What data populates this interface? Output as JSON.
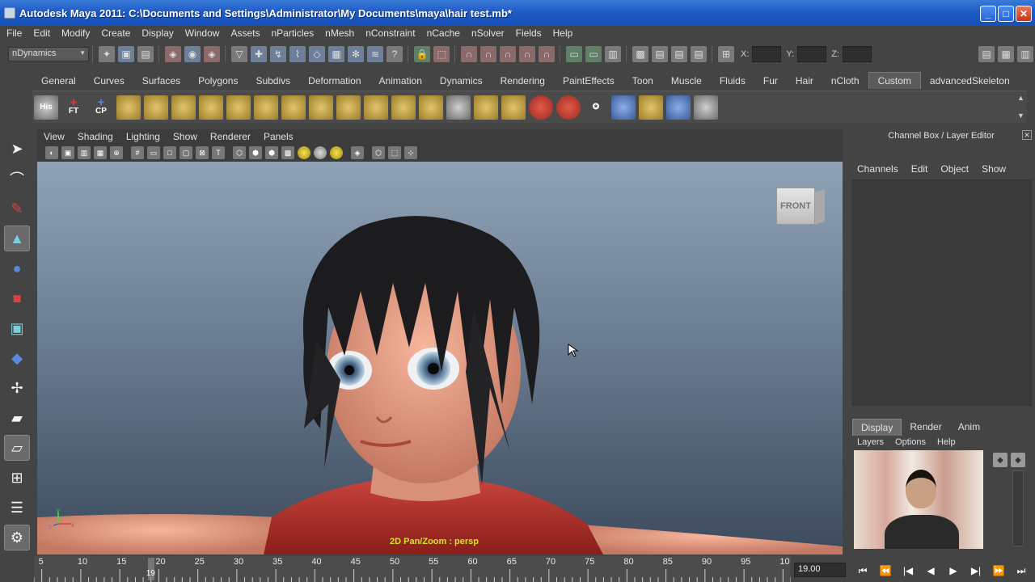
{
  "window": {
    "title": "Autodesk Maya 2011: C:\\Documents and Settings\\Administrator\\My Documents\\maya\\hair test.mb*",
    "minimize": "_",
    "maximize": "□",
    "close": "✕"
  },
  "menubar": [
    "File",
    "Edit",
    "Modify",
    "Create",
    "Display",
    "Window",
    "Assets",
    "nParticles",
    "nMesh",
    "nConstraint",
    "nCache",
    "nSolver",
    "Fields",
    "Help"
  ],
  "statusline": {
    "mode": "nDynamics",
    "x_label": "X:",
    "y_label": "Y:",
    "z_label": "Z:"
  },
  "shelf": {
    "tabs": [
      "General",
      "Curves",
      "Surfaces",
      "Polygons",
      "Subdivs",
      "Deformation",
      "Animation",
      "Dynamics",
      "Rendering",
      "PaintEffects",
      "Toon",
      "Muscle",
      "Fluids",
      "Fur",
      "Hair",
      "nCloth",
      "Custom",
      "advancedSkeleton"
    ],
    "active_tab": "Custom",
    "icon_labels": [
      "His",
      "FT",
      "CP"
    ]
  },
  "viewport": {
    "menu": [
      "View",
      "Shading",
      "Lighting",
      "Show",
      "Renderer",
      "Panels"
    ],
    "viewcube_label": "FRONT",
    "caption": "2D Pan/Zoom : persp",
    "axis_y": "y",
    "axis_z": "z",
    "axis_x": "x"
  },
  "channelbox": {
    "title": "Channel Box / Layer Editor",
    "menu": [
      "Channels",
      "Edit",
      "Object",
      "Show"
    ],
    "layer_tabs": [
      "Display",
      "Render",
      "Anim"
    ],
    "active_layer_tab": "Display",
    "layer_menu": [
      "Layers",
      "Options",
      "Help"
    ]
  },
  "timeslider": {
    "labels": [
      "5",
      "10",
      "15",
      "20",
      "25",
      "30",
      "35",
      "40",
      "45",
      "50",
      "55",
      "60",
      "65",
      "70",
      "75",
      "80",
      "85",
      "90",
      "95",
      "10"
    ],
    "playhead_frame": "19",
    "current_frame": "19.00",
    "range_start": 4,
    "range_end": 101
  },
  "playback_controls": [
    "⏮",
    "⏪",
    "|◀",
    "◀",
    "▶",
    "▶|",
    "⏩",
    "⏭"
  ],
  "colors": {
    "titlebar": "#1e5bc6",
    "background": "#444444",
    "viewport_caption": "#d8e030"
  }
}
